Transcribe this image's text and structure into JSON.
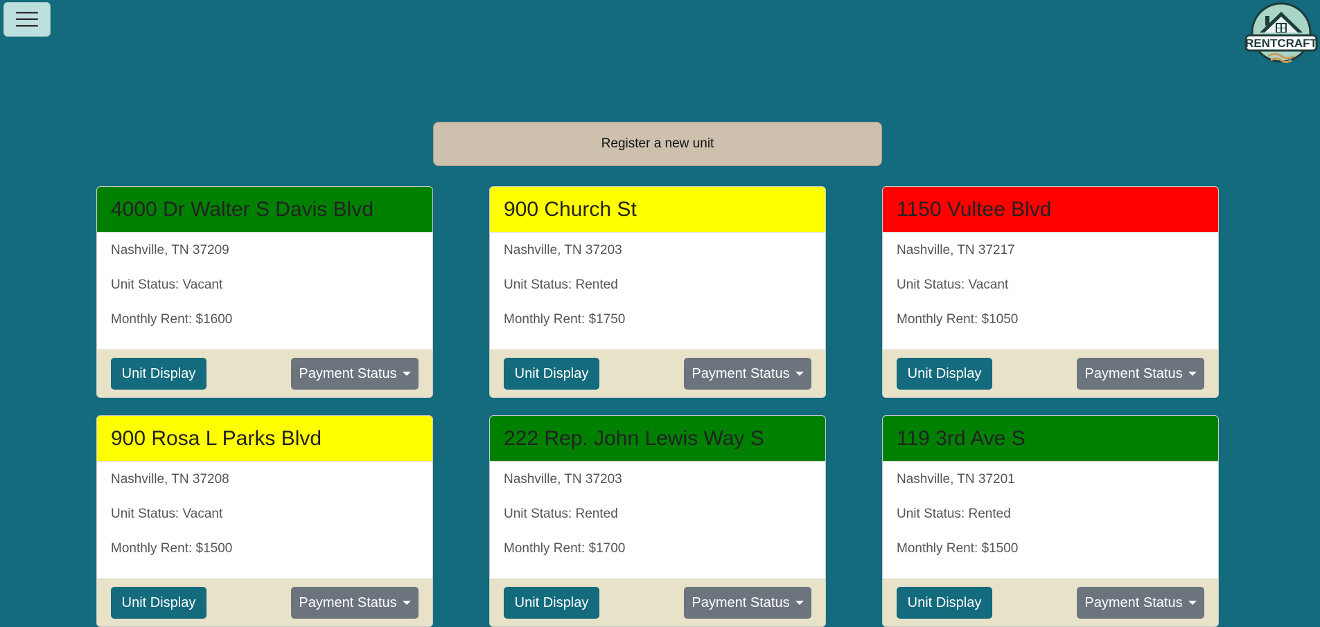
{
  "header": {
    "menu_icon": "hamburger-icon",
    "logo_text": "RENTCRAFT"
  },
  "register": {
    "label": "Register a new unit"
  },
  "colors": {
    "background": "#136b7d",
    "green": "#008000",
    "yellow": "#ffff00",
    "red": "#ff0000",
    "button_primary": "#136b7d",
    "button_secondary": "#6c757d",
    "footer": "#e8e2c8"
  },
  "units": [
    {
      "address": "4000 Dr Walter S Davis Blvd",
      "city": "Nashville, TN 37209",
      "status": "Unit Status: Vacant",
      "rent": "Monthly Rent: $1600",
      "header_color": "#008000",
      "unit_button": "Unit Display",
      "payment_button": "Payment Status"
    },
    {
      "address": "900 Church St",
      "city": "Nashville, TN 37203",
      "status": "Unit Status: Rented",
      "rent": "Monthly Rent: $1750",
      "header_color": "#ffff00",
      "unit_button": "Unit Display",
      "payment_button": "Payment Status"
    },
    {
      "address": "1150 Vultee Blvd",
      "city": "Nashville, TN 37217",
      "status": "Unit Status: Vacant",
      "rent": "Monthly Rent: $1050",
      "header_color": "#ff0000",
      "unit_button": "Unit Display",
      "payment_button": "Payment Status"
    },
    {
      "address": "900 Rosa L Parks Blvd",
      "city": "Nashville, TN 37208",
      "status": "Unit Status: Vacant",
      "rent": "Monthly Rent: $1500",
      "header_color": "#ffff00",
      "unit_button": "Unit Display",
      "payment_button": "Payment Status"
    },
    {
      "address": "222 Rep. John Lewis Way S",
      "city": "Nashville, TN 37203",
      "status": "Unit Status: Rented",
      "rent": "Monthly Rent: $1700",
      "header_color": "#008000",
      "unit_button": "Unit Display",
      "payment_button": "Payment Status"
    },
    {
      "address": "119 3rd Ave S",
      "city": "Nashville, TN 37201",
      "status": "Unit Status: Rented",
      "rent": "Monthly Rent: $1500",
      "header_color": "#008000",
      "unit_button": "Unit Display",
      "payment_button": "Payment Status"
    }
  ]
}
